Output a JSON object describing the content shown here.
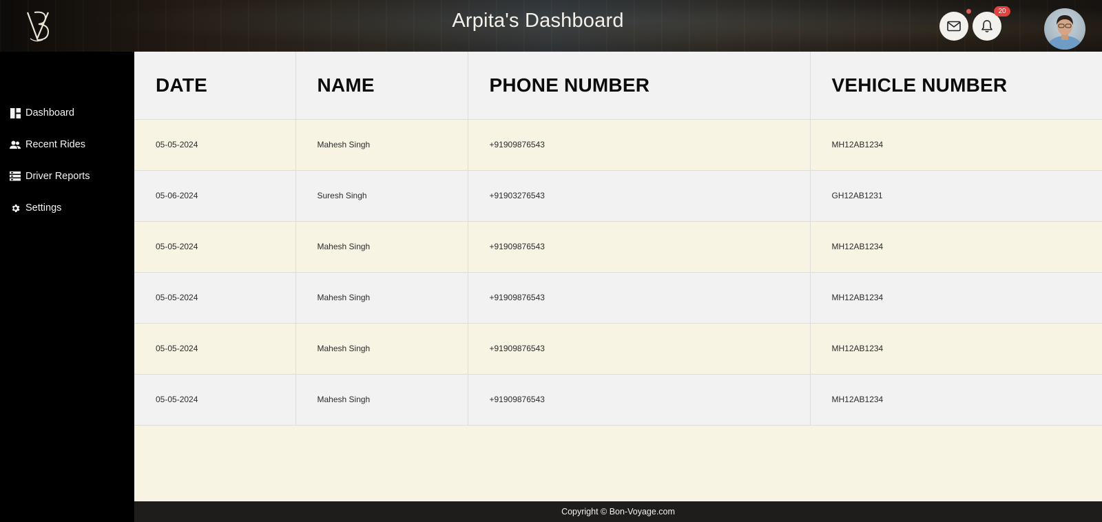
{
  "header": {
    "title": "Arpita's Dashboard",
    "logo_text": "VB",
    "notification_count": "20",
    "mail_icon": "mail-icon",
    "bell_icon": "bell-icon"
  },
  "sidebar": {
    "items": [
      {
        "label": "Dashboard",
        "icon": "dashboard-icon"
      },
      {
        "label": "Recent Rides",
        "icon": "users-icon"
      },
      {
        "label": "Driver Reports",
        "icon": "reports-icon"
      },
      {
        "label": "Settings",
        "icon": "gear-icon"
      }
    ]
  },
  "table": {
    "columns": [
      "DATE",
      "NAME",
      "PHONE NUMBER",
      "VEHICLE NUMBER"
    ],
    "rows": [
      {
        "date": "05-05-2024",
        "name": "Mahesh Singh",
        "phone": "+91909876543",
        "vehicle": "MH12AB1234"
      },
      {
        "date": "05-06-2024",
        "name": "Suresh Singh",
        "phone": "+91903276543",
        "vehicle": "GH12AB1231"
      },
      {
        "date": "05-05-2024",
        "name": "Mahesh Singh",
        "phone": "+91909876543",
        "vehicle": "MH12AB1234"
      },
      {
        "date": "05-05-2024",
        "name": "Mahesh Singh",
        "phone": "+91909876543",
        "vehicle": "MH12AB1234"
      },
      {
        "date": "05-05-2024",
        "name": "Mahesh Singh",
        "phone": "+91909876543",
        "vehicle": "MH12AB1234"
      },
      {
        "date": "05-05-2024",
        "name": "Mahesh Singh",
        "phone": "+91909876543",
        "vehicle": "MH12AB1234"
      }
    ]
  },
  "footer": {
    "copyright": "Copyright © Bon-Voyage.com"
  },
  "colors": {
    "sidebar_bg": "#000000",
    "row_cream": "#f7f4e3",
    "row_gray": "#f2f2f2",
    "footer_bg": "#1f1d1b",
    "badge_red": "#e0433f"
  }
}
